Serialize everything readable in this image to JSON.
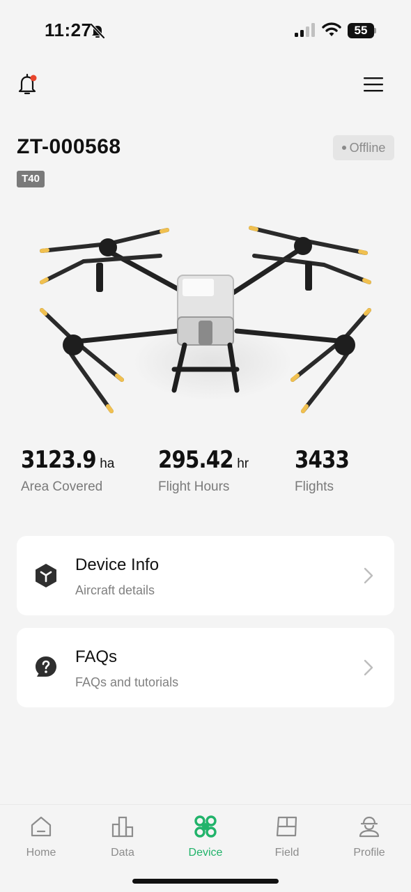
{
  "status_bar": {
    "time": "11:27",
    "battery": "55",
    "icons": [
      "bell-slash-icon",
      "signal-icon",
      "wifi-icon",
      "battery-icon"
    ]
  },
  "header": {
    "icons": [
      "notification-bell-icon",
      "menu-icon"
    ]
  },
  "device": {
    "name": "ZT-000568",
    "status": "Offline",
    "model": "T40"
  },
  "stats": [
    {
      "value": "3123.9",
      "unit": "ha",
      "label": "Area Covered"
    },
    {
      "value": "295.42",
      "unit": "hr",
      "label": "Flight Hours"
    },
    {
      "value": "3433",
      "unit": "",
      "label": "Flights"
    }
  ],
  "cards": [
    {
      "title": "Device Info",
      "subtitle": "Aircraft details",
      "icon": "cube-icon"
    },
    {
      "title": "FAQs",
      "subtitle": "FAQs and tutorials",
      "icon": "question-icon"
    }
  ],
  "tabs": [
    {
      "label": "Home",
      "icon": "home-icon",
      "active": false
    },
    {
      "label": "Data",
      "icon": "bar-chart-icon",
      "active": false
    },
    {
      "label": "Device",
      "icon": "drone-icon",
      "active": true
    },
    {
      "label": "Field",
      "icon": "field-icon",
      "active": false
    },
    {
      "label": "Profile",
      "icon": "profile-icon",
      "active": false
    }
  ],
  "colors": {
    "accent": "#21b36a",
    "notification_dot": "#e8452c",
    "background": "#f4f4f4"
  }
}
